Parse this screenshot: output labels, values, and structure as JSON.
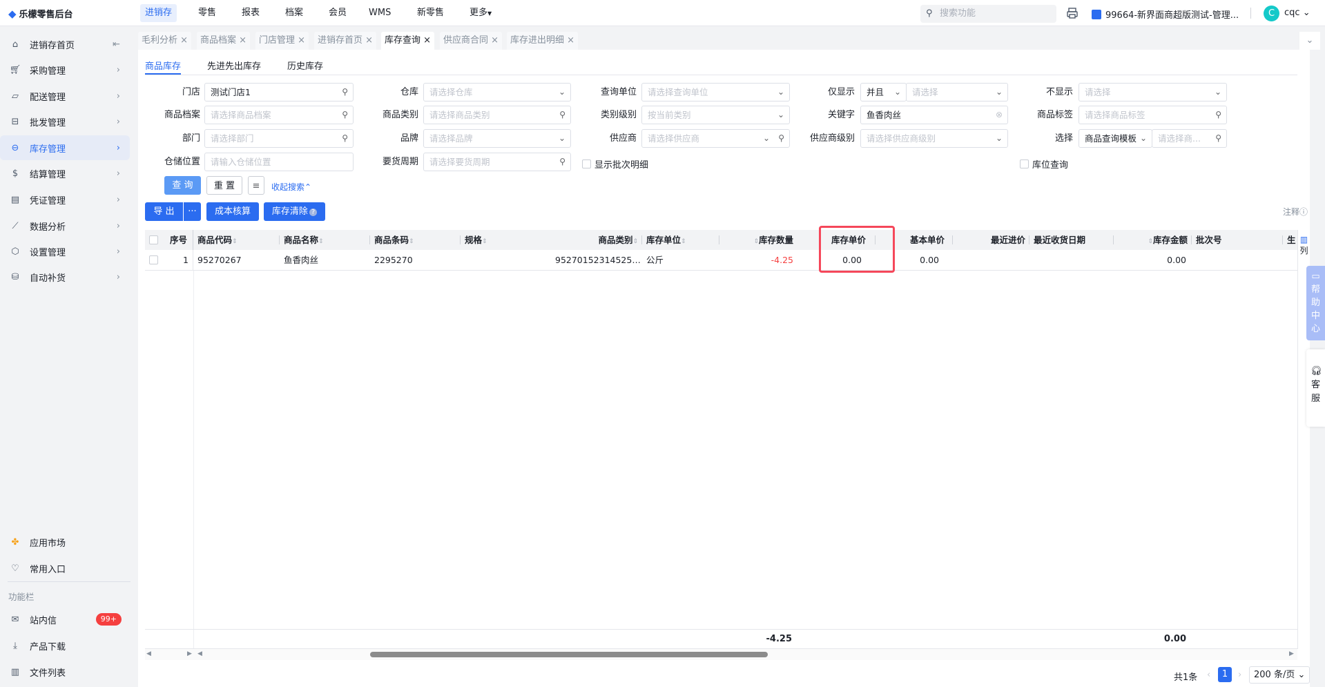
{
  "app": {
    "logo_text": "乐檬零售后台",
    "accent": "#2b6cf0"
  },
  "topnav": {
    "items": [
      "进销存",
      "零售",
      "报表",
      "档案",
      "会员",
      "WMS",
      "新零售",
      "更多"
    ],
    "active": "进销存",
    "search_placeholder": "搜索功能",
    "store": "99664-新界面商超版测试-管理...",
    "avatar_letter": "C",
    "user": "cqc"
  },
  "sidebar": {
    "items": [
      {
        "label": "进销存首页",
        "icon": "home-icon"
      },
      {
        "label": "采购管理",
        "icon": "cart-icon"
      },
      {
        "label": "配送管理",
        "icon": "map-icon"
      },
      {
        "label": "批发管理",
        "icon": "box-icon"
      },
      {
        "label": "库存管理",
        "icon": "inventory-icon",
        "active": true
      },
      {
        "label": "结算管理",
        "icon": "dollar-icon"
      },
      {
        "label": "凭证管理",
        "icon": "document-icon"
      },
      {
        "label": "数据分析",
        "icon": "chart-icon"
      },
      {
        "label": "设置管理",
        "icon": "settings-icon"
      },
      {
        "label": "自动补货",
        "icon": "restock-icon"
      }
    ],
    "bottom": [
      {
        "label": "应用市场",
        "icon": "app-market-icon"
      },
      {
        "label": "常用入口",
        "icon": "heart-icon"
      }
    ],
    "section_label": "功能栏",
    "tools": [
      {
        "label": "站内信",
        "icon": "mail-icon",
        "badge": "99+"
      },
      {
        "label": "产品下载",
        "icon": "download-icon"
      },
      {
        "label": "文件列表",
        "icon": "file-list-icon"
      }
    ]
  },
  "tabs": [
    "毛利分析",
    "商品档案",
    "门店管理",
    "进销存首页",
    "库存查询",
    "供应商合同",
    "库存进出明细"
  ],
  "active_tab": "库存查询",
  "subtabs": [
    "商品库存",
    "先进先出库存",
    "历史库存"
  ],
  "form": {
    "store": {
      "label": "门店",
      "value": "测试门店1"
    },
    "warehouse": {
      "label": "仓库",
      "placeholder": "请选择仓库"
    },
    "query_unit": {
      "label": "查询单位",
      "placeholder": "请选择查询单位"
    },
    "only_show": {
      "label": "仅显示",
      "mode": "并且",
      "placeholder": "请选择"
    },
    "not_show": {
      "label": "不显示",
      "placeholder": "请选择"
    },
    "product_file": {
      "label": "商品档案",
      "placeholder": "请选择商品档案"
    },
    "category": {
      "label": "商品类别",
      "placeholder": "请选择商品类别"
    },
    "category_level": {
      "label": "类别级别",
      "placeholder": "按当前类别"
    },
    "keyword": {
      "label": "关键字",
      "value": "鱼香肉丝"
    },
    "tag": {
      "label": "商品标签",
      "placeholder": "请选择商品标签"
    },
    "dept": {
      "label": "部门",
      "placeholder": "请选择部门"
    },
    "brand": {
      "label": "品牌",
      "placeholder": "请选择品牌"
    },
    "supplier": {
      "label": "供应商",
      "placeholder": "请选择供应商"
    },
    "supplier_level": {
      "label": "供应商级别",
      "placeholder": "请选择供应商级别"
    },
    "select": {
      "label": "选择",
      "template": "商品查询模板",
      "placeholder": "请选择商..."
    },
    "location": {
      "label": "仓储位置",
      "placeholder": "请输入仓储位置"
    },
    "cycle": {
      "label": "要货周期",
      "placeholder": "请选择要货周期"
    },
    "batch_detail": "显示批次明细",
    "bin_query": "库位查询",
    "query_btn": "查 询",
    "reset_btn": "重 置",
    "collapse": "收起搜索"
  },
  "actions": {
    "export": "导 出",
    "more": "···",
    "cost": "成本核算",
    "clear": "库存清除",
    "note": "注释"
  },
  "table": {
    "columns": [
      "序号",
      "商品代码",
      "商品名称",
      "商品条码",
      "规格",
      "商品类别",
      "库存单位",
      "库存数量",
      "库存单价",
      "基本单价",
      "最近进价",
      "最近收货日期",
      "库存金额",
      "批次号",
      "生"
    ],
    "rows": [
      [
        "1",
        "95270267",
        "鱼香肉丝",
        "2295270",
        "",
        "95270152314525…",
        "公斤",
        "-4.25",
        "0.00",
        "0.00",
        "",
        "",
        "0.00",
        "",
        ""
      ]
    ],
    "totals": {
      "qty": "-4.25",
      "amount": "0.00"
    },
    "column_settings": "列",
    "negative_color": "#f53f3f",
    "highlight_color": "#f5475a"
  },
  "pagination": {
    "total": "共1条",
    "page": "1",
    "page_size": "200 条/页"
  },
  "float": {
    "help": "帮助中心",
    "service": "客服"
  }
}
